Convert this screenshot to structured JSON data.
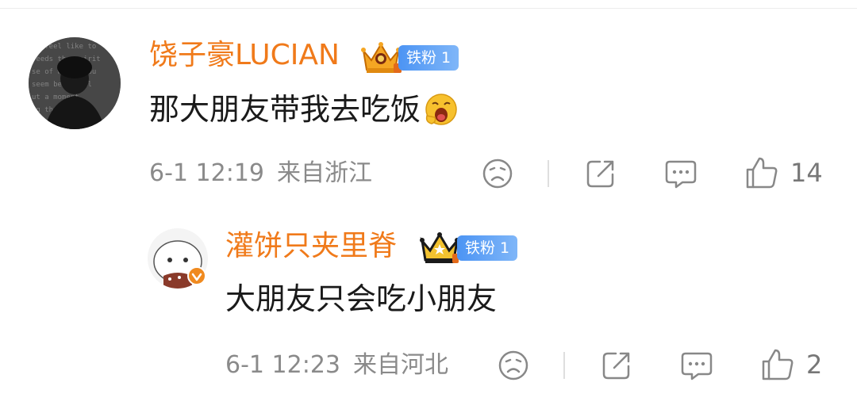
{
  "comments": [
    {
      "username": "饶子豪LUCIAN",
      "fan_badge": "铁粉 1",
      "text": "那大朋友带我去吃饭",
      "time": "6-1 12:19",
      "location": "来自浙江",
      "likes": "14"
    },
    {
      "username": "灌饼只夹里脊",
      "fan_badge": "铁粉 1",
      "text": "大朋友只会吃小朋友",
      "time": "6-1 12:23",
      "location": "来自河北",
      "likes": "2"
    }
  ],
  "colors": {
    "username": "#f07a1a",
    "badge_blue": "#4c94f4",
    "verified": "#f08a1f",
    "meta_gray": "#8a8a8a"
  },
  "icons": [
    "sad-face-icon",
    "share-icon",
    "comment-icon",
    "thumbs-up-icon",
    "crown-icon",
    "verified-icon",
    "yawn-emoji-icon"
  ]
}
